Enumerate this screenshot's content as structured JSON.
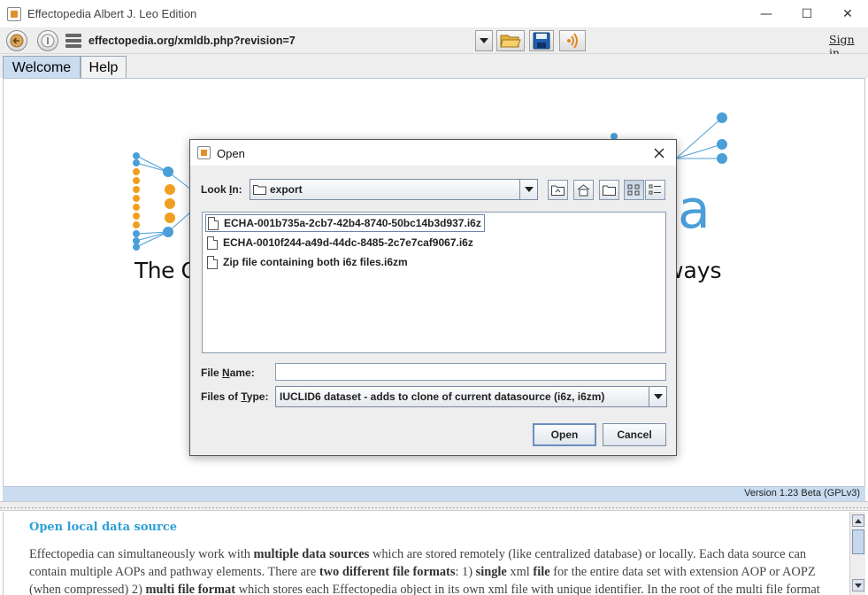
{
  "window": {
    "title": "Effectopedia   Albert J. Leo Edition",
    "minimize": "—",
    "maximize": "☐",
    "close": "✕"
  },
  "toolbar": {
    "url": "effectopedia.org/xmldb.php?revision=7",
    "sign_in": "Sign in"
  },
  "tabs": [
    {
      "label": "Welcome",
      "active": true
    },
    {
      "label": "Help",
      "active": false
    }
  ],
  "logo": {
    "tagline_left": "The O",
    "tagline_right": "ways",
    "letter": "a"
  },
  "version_label": "Version 1.23 Beta (GPLv3)",
  "help_panel": {
    "title": "Open local data source",
    "paragraph": [
      {
        "text": "Effectopedia can simultaneously work with ",
        "bold": false
      },
      {
        "text": "multiple data sources",
        "bold": true
      },
      {
        "text": " which are stored remotely (like centralized database) or locally. Each data source can contain multiple AOPs and pathway elements. There are ",
        "bold": false
      },
      {
        "text": "two different file formats",
        "bold": true
      },
      {
        "text": ": 1) ",
        "bold": false
      },
      {
        "text": "single",
        "bold": true
      },
      {
        "text": " xml ",
        "bold": false
      },
      {
        "text": "file",
        "bold": true
      },
      {
        "text": " for the entire data set with extension AOP or AOPZ (when compressed) 2) ",
        "bold": false
      },
      {
        "text": "multi file format",
        "bold": true
      },
      {
        "text": " which stores each Effectopedia object in its own xml file with unique identifier. In the root of the multi file format",
        "bold": false
      }
    ]
  },
  "dialog": {
    "title": "Open",
    "look_in_label_pre": "Look ",
    "look_in_label_mnemonic": "I",
    "look_in_label_post": "n:",
    "look_in_value": "export",
    "files": [
      {
        "name": "ECHA-001b735a-2cb7-42b4-8740-50bc14b3d937.i6z",
        "focused": true
      },
      {
        "name": "ECHA-0010f244-a49d-44dc-8485-2c7e7caf9067.i6z",
        "focused": false
      },
      {
        "name": "Zip file containing both i6z files.i6zm",
        "focused": false
      }
    ],
    "file_name_label_pre": "File ",
    "file_name_label_mnemonic": "N",
    "file_name_label_post": "ame:",
    "file_name_value": "",
    "files_of_type_label_pre": "Files of ",
    "files_of_type_label_mnemonic": "T",
    "files_of_type_label_post": "ype:",
    "files_of_type_value": "IUCLID6 dataset - adds to clone of current datasource (i6z, i6zm)",
    "open_button": "Open",
    "cancel_button": "Cancel"
  },
  "colors": {
    "logo_blue": "#4a9fd8",
    "logo_orange": "#f0a020",
    "help_title": "#2e9fd6",
    "tab_active": "#c9dcf0"
  }
}
